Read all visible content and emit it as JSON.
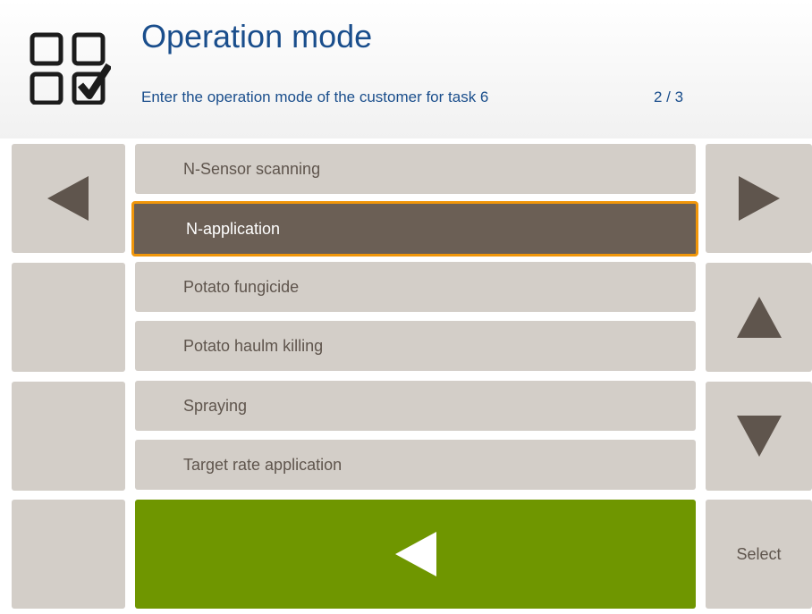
{
  "header": {
    "title": "Operation mode",
    "subtitle": "Enter the operation mode of the customer for task 6",
    "page_indicator": "2 / 3",
    "icon": "checklist-icon"
  },
  "list": {
    "items": [
      {
        "label": "N-Sensor scanning",
        "selected": false
      },
      {
        "label": "N-application",
        "selected": true
      },
      {
        "label": "Potato fungicide",
        "selected": false
      },
      {
        "label": "Potato haulm killing",
        "selected": false
      },
      {
        "label": "Spraying",
        "selected": false
      },
      {
        "label": "Target rate application",
        "selected": false
      }
    ]
  },
  "buttons": {
    "left_top": "triangle-left-icon",
    "right_top": "triangle-right-icon",
    "scroll_up": "triangle-up-icon",
    "scroll_down": "triangle-down-icon",
    "back": "back-arrow-icon",
    "select_label": "Select"
  },
  "colors": {
    "title": "#1a4e8c",
    "button_bg": "#d3cec8",
    "selected_bg": "#6b5f55",
    "selected_border": "#f0960a",
    "back_button": "#6f9600",
    "arrow": "#5f554d"
  }
}
